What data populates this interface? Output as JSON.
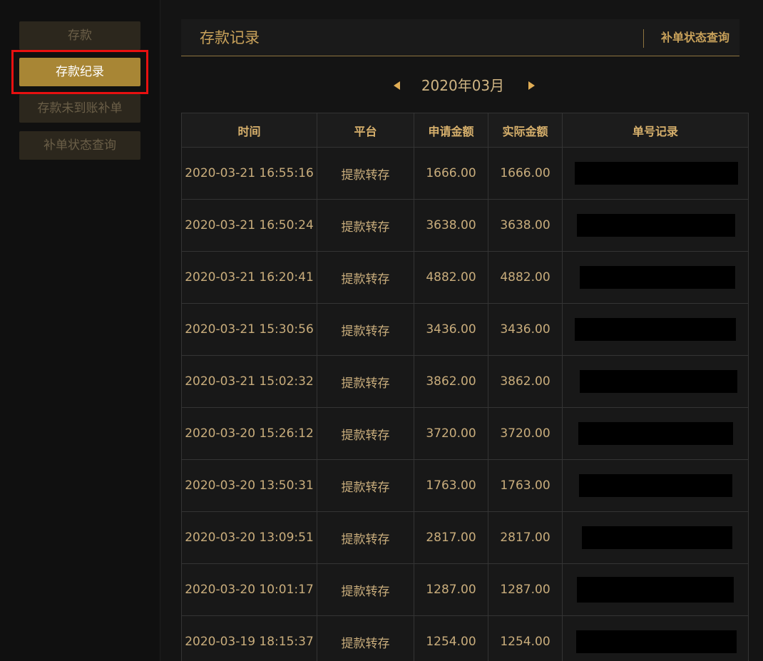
{
  "sidebar": {
    "items": [
      {
        "label": "存款"
      },
      {
        "label": "存款纪录"
      },
      {
        "label": "存款未到账补单"
      },
      {
        "label": "补单状态查询"
      }
    ]
  },
  "header": {
    "title": "存款记录",
    "link": "补单状态查询"
  },
  "month_nav": {
    "label": "2020年03月"
  },
  "table": {
    "columns": [
      "时间",
      "平台",
      "申请金额",
      "实际金额",
      "单号记录"
    ],
    "rows": [
      {
        "time": "2020-03-21 16:55:16",
        "platform": "提款转存",
        "requested": "1666.00",
        "actual": "1666.00"
      },
      {
        "time": "2020-03-21 16:50:24",
        "platform": "提款转存",
        "requested": "3638.00",
        "actual": "3638.00"
      },
      {
        "time": "2020-03-21 16:20:41",
        "platform": "提款转存",
        "requested": "4882.00",
        "actual": "4882.00"
      },
      {
        "time": "2020-03-21 15:30:56",
        "platform": "提款转存",
        "requested": "3436.00",
        "actual": "3436.00"
      },
      {
        "time": "2020-03-21 15:02:32",
        "platform": "提款转存",
        "requested": "3862.00",
        "actual": "3862.00"
      },
      {
        "time": "2020-03-20 15:26:12",
        "platform": "提款转存",
        "requested": "3720.00",
        "actual": "3720.00"
      },
      {
        "time": "2020-03-20 13:50:31",
        "platform": "提款转存",
        "requested": "1763.00",
        "actual": "1763.00"
      },
      {
        "time": "2020-03-20 13:09:51",
        "platform": "提款转存",
        "requested": "2817.00",
        "actual": "2817.00"
      },
      {
        "time": "2020-03-20 10:01:17",
        "platform": "提款转存",
        "requested": "1287.00",
        "actual": "1287.00"
      },
      {
        "time": "2020-03-19 18:15:37",
        "platform": "提款转存",
        "requested": "1254.00",
        "actual": "1254.00"
      }
    ]
  },
  "colors": {
    "accent": "#a88635",
    "text_gold": "#c9ad7c",
    "highlight_outline": "#e81010"
  }
}
